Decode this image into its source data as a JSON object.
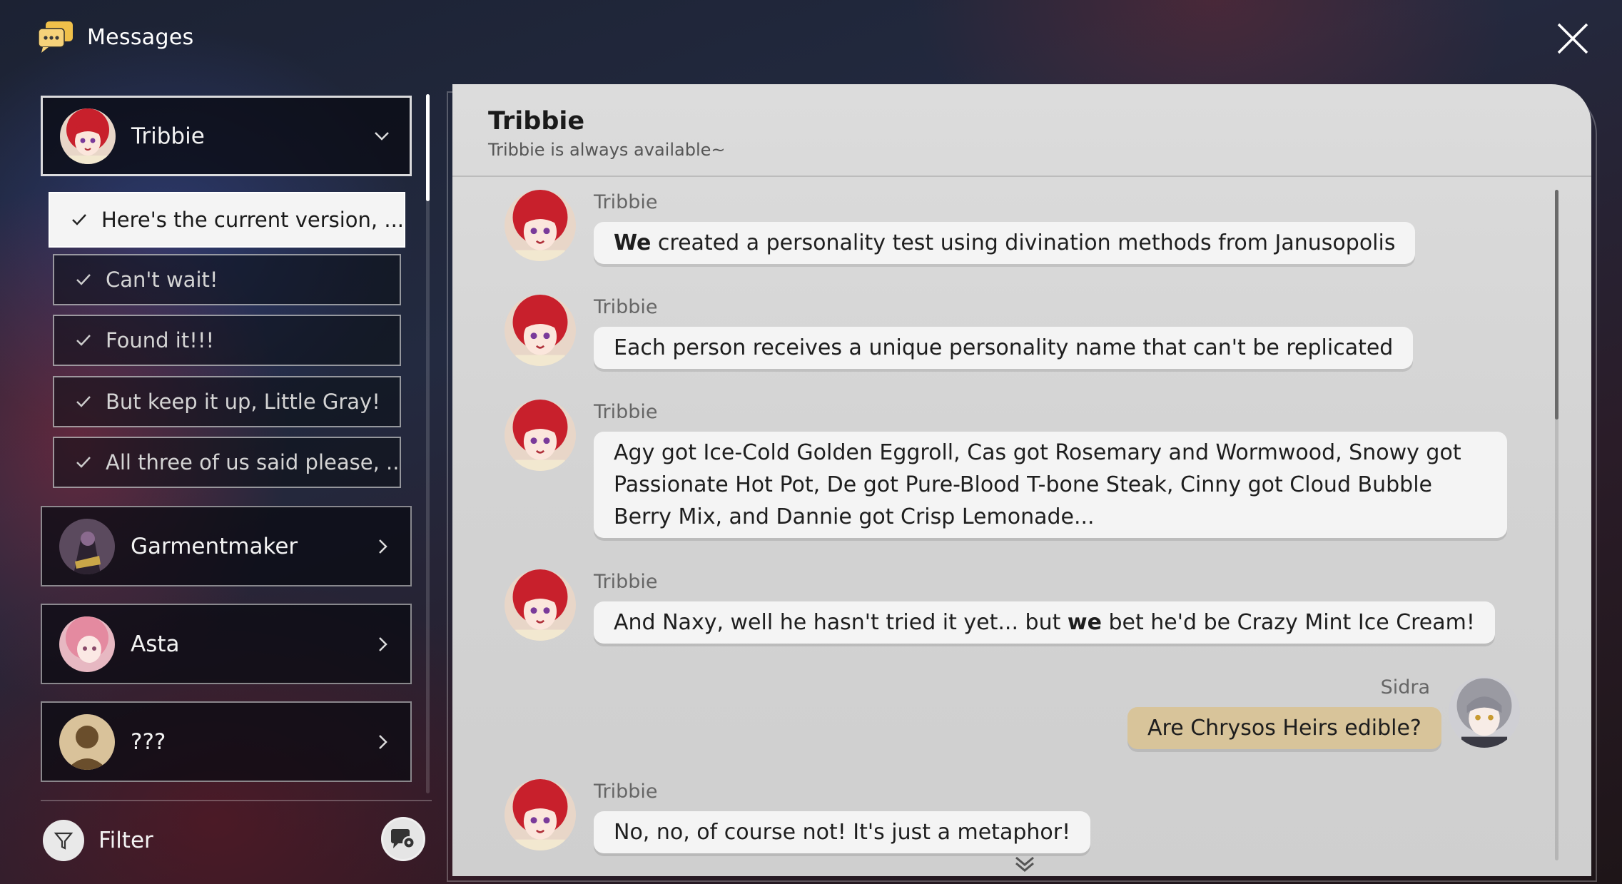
{
  "header": {
    "title": "Messages"
  },
  "contacts": [
    {
      "name": "Tribbie",
      "expanded": true,
      "avatar": "red-haired-girl-avatar"
    },
    {
      "name": "Garmentmaker",
      "expanded": false,
      "avatar": "garmentmaker-avatar"
    },
    {
      "name": "Asta",
      "expanded": false,
      "avatar": "pink-haired-girl-avatar"
    },
    {
      "name": "???",
      "expanded": false,
      "avatar": "unknown-silhouette-avatar"
    }
  ],
  "threads": [
    {
      "label": "Here's the current version, ...",
      "selected": true
    },
    {
      "label": "Can't wait!",
      "selected": false
    },
    {
      "label": "Found it!!!",
      "selected": false
    },
    {
      "label": "But keep it up, Little Gray!",
      "selected": false
    },
    {
      "label": "All three of us said please, ...",
      "selected": false
    }
  ],
  "filter": {
    "label": "Filter"
  },
  "chat": {
    "name": "Tribbie",
    "status": "Tribbie is always available~",
    "messages": [
      {
        "sender": "Tribbie",
        "bold": "We",
        "text": " created a personality test using divination methods from Janusopolis",
        "self": false
      },
      {
        "sender": "Tribbie",
        "text": "Each person receives a unique personality name that can't be replicated",
        "self": false
      },
      {
        "sender": "Tribbie",
        "text": "Agy got Ice-Cold Golden Eggroll, Cas got Rosemary and Wormwood, Snowy got Passionate Hot Pot, De got Pure-Blood T-bone Steak, Cinny got Cloud Bubble Berry Mix, and Dannie got Crisp Lemonade...",
        "self": false
      },
      {
        "sender": "Tribbie",
        "pre": "And Naxy, well he hasn't tried it yet... but ",
        "bold": "we",
        "post": " bet he'd be Crazy Mint Ice Cream!",
        "self": false
      },
      {
        "sender": "Sidra",
        "text": "Are Chrysos Heirs edible?",
        "self": true
      },
      {
        "sender": "Tribbie",
        "text": "No, no, of course not! It's just a metaphor!",
        "self": false
      }
    ]
  },
  "colors": {
    "self_bubble": "#d8c49a",
    "bubble": "#f4f4f4",
    "panel": "#d6d6d6"
  }
}
